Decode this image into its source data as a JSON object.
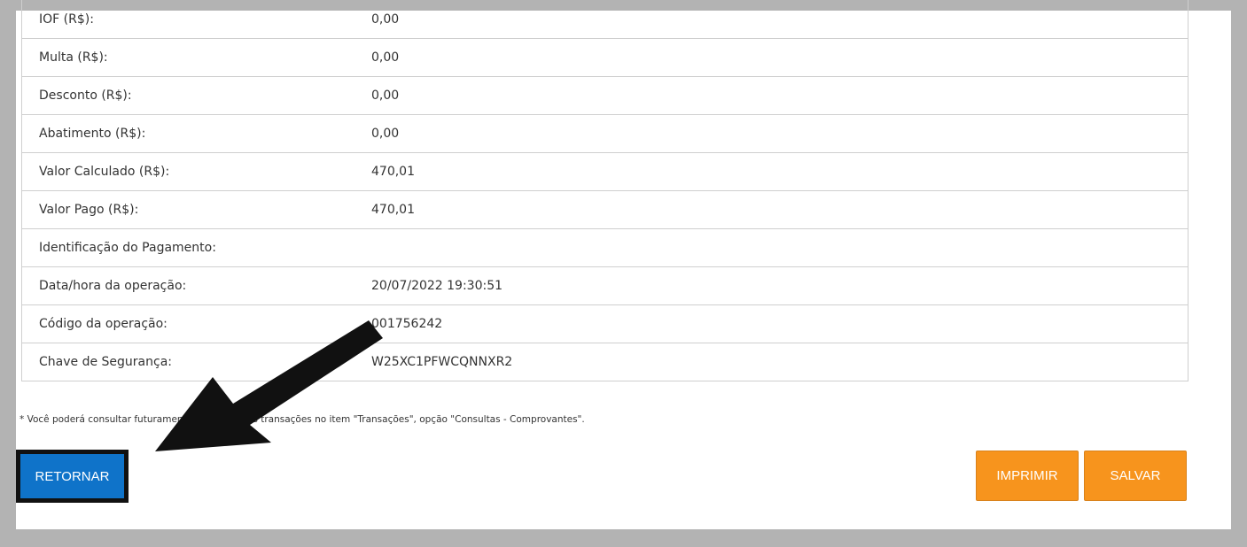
{
  "details": [
    {
      "label": "IOF (R$):",
      "value": "0,00"
    },
    {
      "label": "Multa (R$):",
      "value": "0,00"
    },
    {
      "label": "Desconto (R$):",
      "value": "0,00"
    },
    {
      "label": "Abatimento (R$):",
      "value": "0,00"
    },
    {
      "label": "Valor Calculado (R$):",
      "value": "470,01"
    },
    {
      "label": "Valor Pago (R$):",
      "value": "470,01"
    },
    {
      "label": "Identificação do Pagamento:",
      "value": ""
    },
    {
      "label": "Data/hora da operação:",
      "value": "20/07/2022 19:30:51"
    },
    {
      "label": "Código da operação:",
      "value": "001756242"
    },
    {
      "label": "Chave de Segurança:",
      "value": "W25XC1PFWCQNNXR2"
    }
  ],
  "note": "* Você poderá consultar futuramente essa e outras transações no item \"Transações\", opção \"Consultas - Comprovantes\".",
  "buttons": {
    "return_label": "RETORNAR",
    "print_label": "IMPRIMIR",
    "save_label": "SALVAR"
  },
  "colors": {
    "return_button": "#0f73c9",
    "action_buttons": "#f7941d",
    "annotation_arrow": "#111111"
  },
  "icons": {
    "annotation": "arrow-pointing-to-return-button"
  }
}
